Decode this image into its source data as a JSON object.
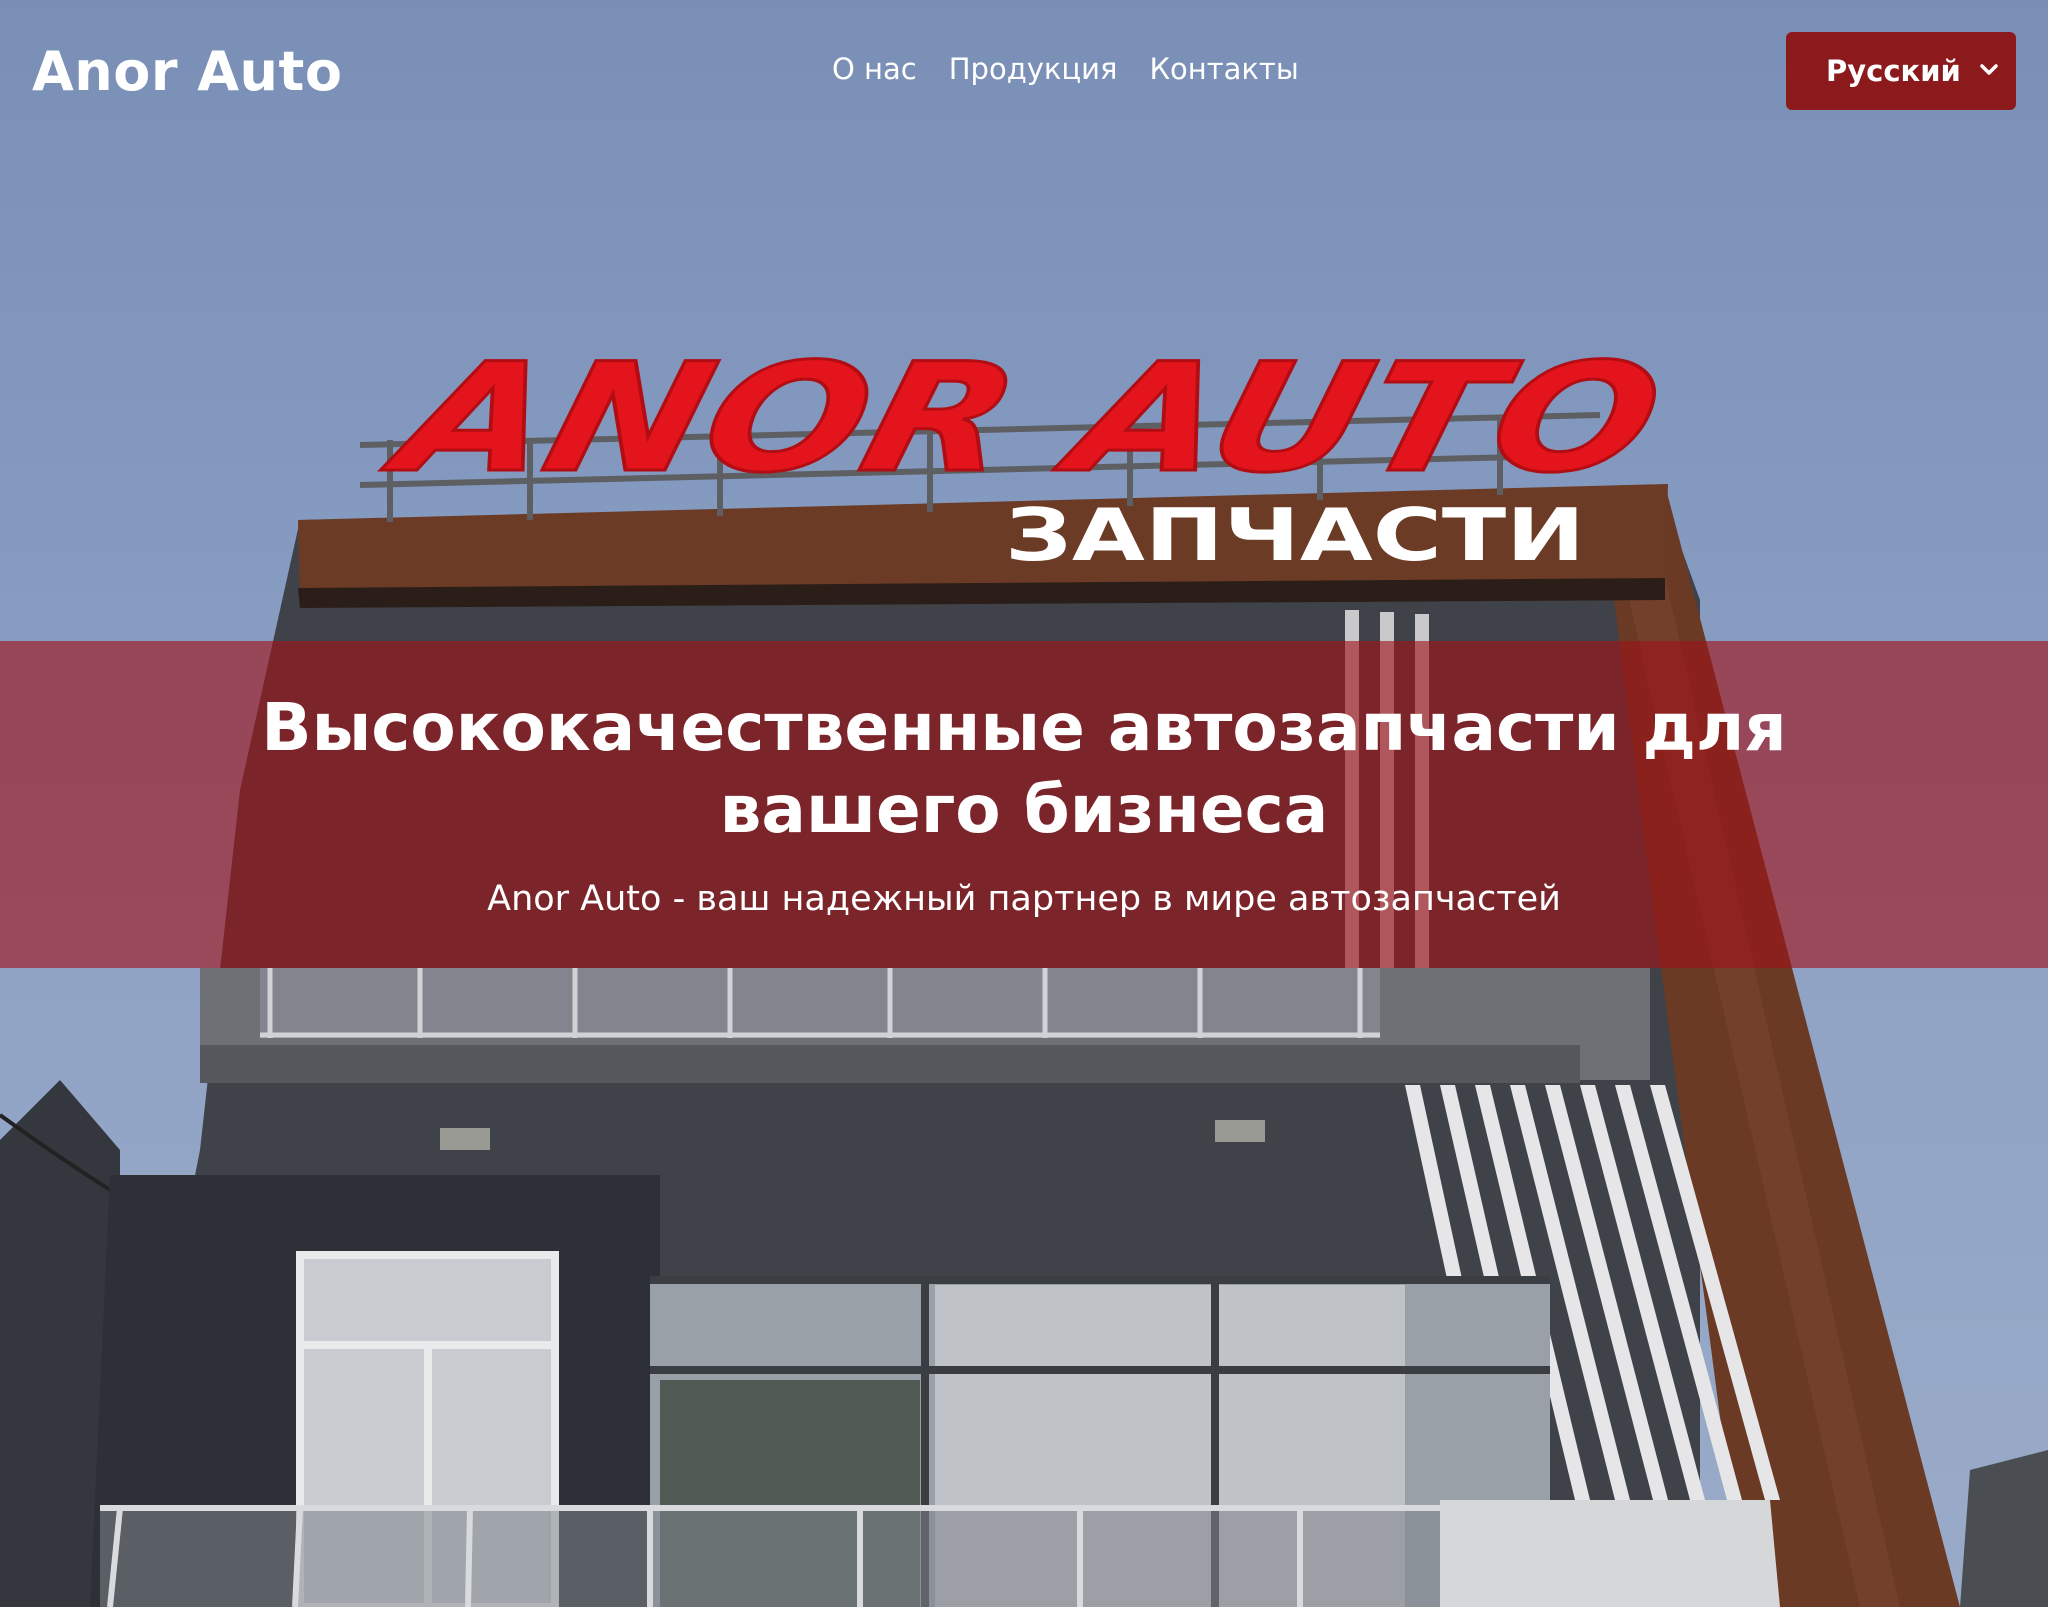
{
  "brand": "Anor Auto",
  "nav": {
    "items": [
      "О нас",
      "Продукция",
      "Контакты"
    ]
  },
  "language": {
    "selected": "Русский",
    "icon": "chevron-down-icon"
  },
  "hero": {
    "heading": "Высококачественные автозапчасти для вашего бизнеса",
    "subheading": "Anor Auto - ваш надежный партнер в мире автозапчастей",
    "sign_main": "ANOR AUTO",
    "sign_sub": "ЗАПЧАСТИ"
  },
  "colors": {
    "accent": "#8c1a1c",
    "banner": "#a01218",
    "sign_red": "#e3141c",
    "sky": "#8499bf"
  }
}
